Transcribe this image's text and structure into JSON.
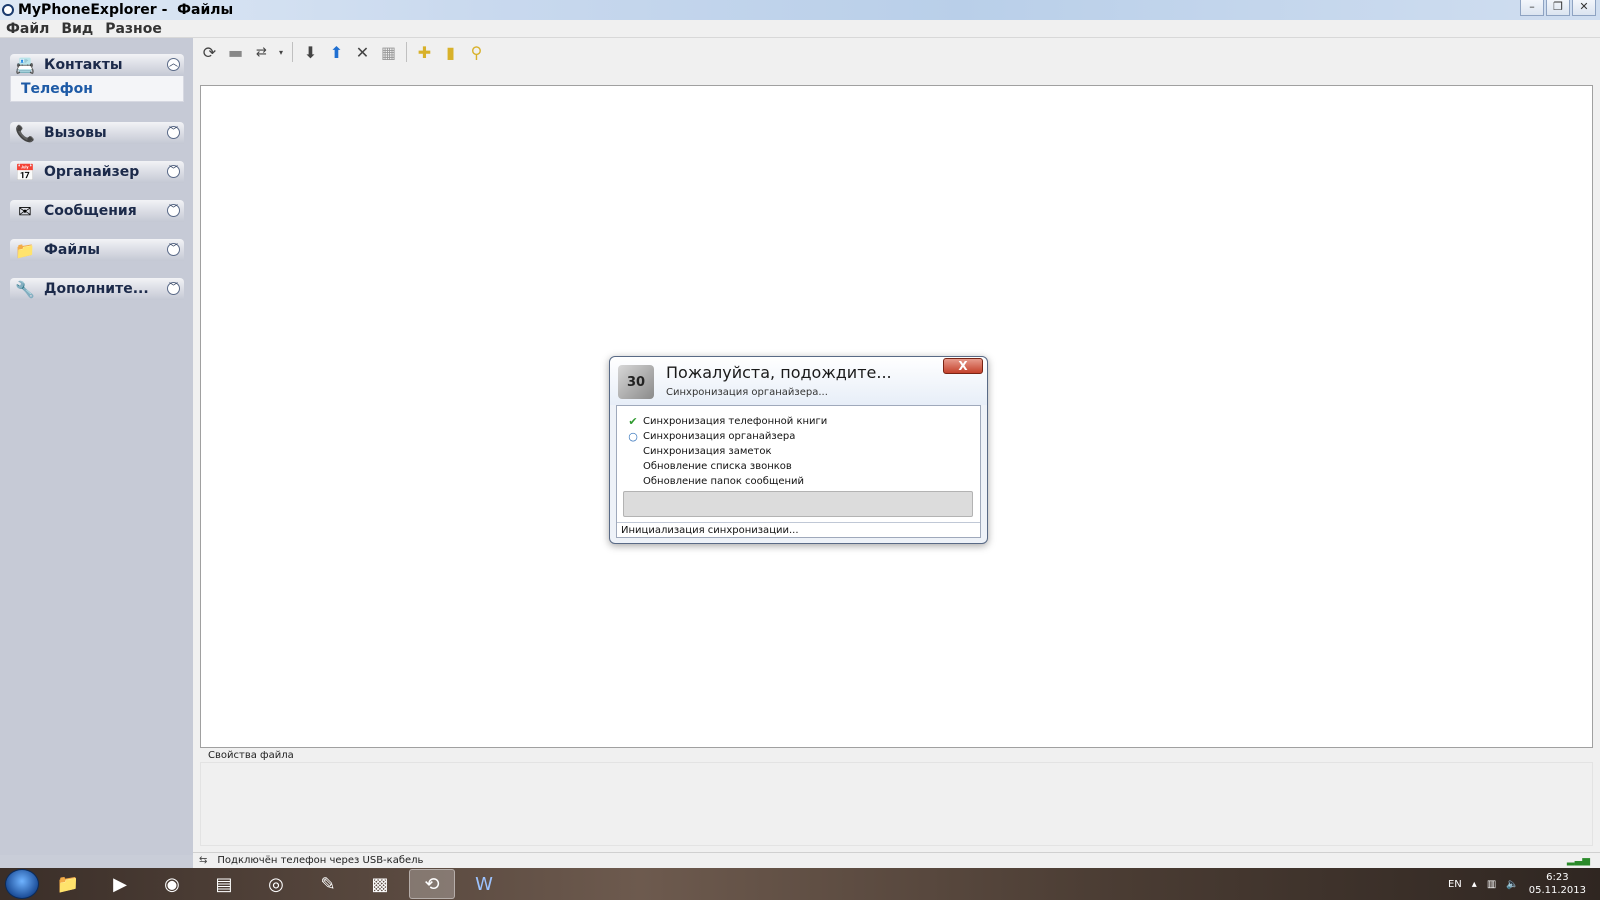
{
  "window": {
    "title": "MyPhoneExplorer -  Файлы",
    "controls": {
      "minimize": "–",
      "maximize": "❐",
      "close": "✕"
    }
  },
  "menu": [
    "Файл",
    "Вид",
    "Разное"
  ],
  "sidebar": {
    "groups": [
      {
        "label": "Контакты",
        "icon": "contacts-icon",
        "expanded": true,
        "sub": "Телефон"
      },
      {
        "label": "Вызовы",
        "icon": "calls-icon",
        "expanded": false
      },
      {
        "label": "Органайзер",
        "icon": "organizer-icon",
        "expanded": false
      },
      {
        "label": "Сообщения",
        "icon": "messages-icon",
        "expanded": false
      },
      {
        "label": "Файлы",
        "icon": "folder-icon",
        "expanded": false
      },
      {
        "label": "Дополните...",
        "icon": "tools-icon",
        "expanded": false
      }
    ]
  },
  "toolbar": {
    "icons": [
      "refresh-icon",
      "stop-icon",
      "sync-icon",
      "dropdown-icon",
      "download-icon",
      "upload-icon",
      "delete-icon",
      "properties-icon",
      "new-folder-icon",
      "folder-up-icon",
      "folder-search-icon"
    ]
  },
  "properties": {
    "label": "Свойства файла"
  },
  "status": {
    "text": "Подключён телефон           через USB-кабель"
  },
  "dialog": {
    "title": "Пожалуйста, подождите...",
    "subtitle": "Синхронизация органайзера...",
    "icon_text": "30",
    "close": "X",
    "steps": [
      {
        "label": "Синхронизация телефонной книги",
        "state": "done"
      },
      {
        "label": "Синхронизация органайзера",
        "state": "active"
      },
      {
        "label": "Синхронизация заметок",
        "state": "pending"
      },
      {
        "label": "Обновление списка звонков",
        "state": "pending"
      },
      {
        "label": "Обновление папок сообщений",
        "state": "pending"
      }
    ],
    "progress": 0,
    "status": "Инициализация синхронизации..."
  },
  "taskbar": {
    "lang": "EN",
    "time": "6:23",
    "date": "05.11.2013",
    "apps": [
      "explorer-icon",
      "media-player-icon",
      "chrome-icon",
      "task-manager-icon",
      "dvd-icon",
      "pen-icon",
      "minecraft-icon",
      "myphoneexplorer-icon",
      "word-icon"
    ]
  }
}
